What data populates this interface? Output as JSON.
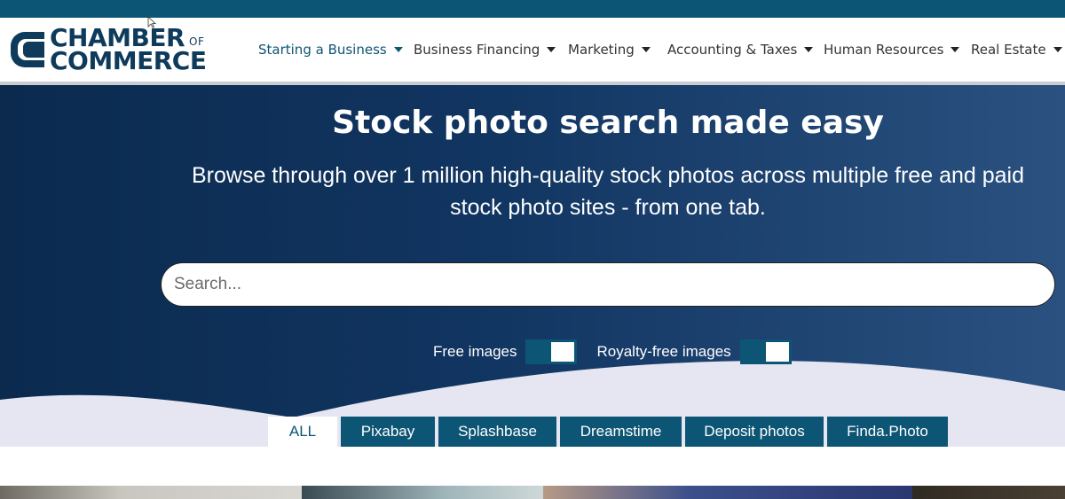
{
  "brand": {
    "line1": "CHAMBER",
    "of": "OF",
    "line2": "COMMERCE",
    "color": "#0e3a5b"
  },
  "nav": {
    "items": [
      {
        "label": "Starting a Business",
        "active": true
      },
      {
        "label": "Business Financing",
        "active": false
      },
      {
        "label": "Marketing",
        "active": false
      },
      {
        "label": "Accounting & Taxes",
        "active": false
      },
      {
        "label": "Human Resources",
        "active": false
      },
      {
        "label": "Real Estate",
        "active": false
      }
    ]
  },
  "hero": {
    "title": "Stock photo search made easy",
    "subtitle": "Browse through over 1 million high-quality stock photos across multiple free and paid stock photo sites - from one tab."
  },
  "search": {
    "placeholder": "Search..."
  },
  "filters": {
    "free_label": "Free images",
    "royalty_label": "Royalty-free images"
  },
  "tabs": [
    {
      "label": "ALL",
      "active": true
    },
    {
      "label": "Pixabay",
      "active": false
    },
    {
      "label": "Splashbase",
      "active": false
    },
    {
      "label": "Dreamstime",
      "active": false
    },
    {
      "label": "Deposit photos",
      "active": false
    },
    {
      "label": "Finda.Photo",
      "active": false
    }
  ],
  "colors": {
    "accent": "#0d5575",
    "hero_dark": "#0b2a4e",
    "hero_light": "#2a5180",
    "wave": "#e6e6f2"
  },
  "icons": {
    "caret": "caret-down-icon",
    "logo": "chamber-logo-mark"
  }
}
